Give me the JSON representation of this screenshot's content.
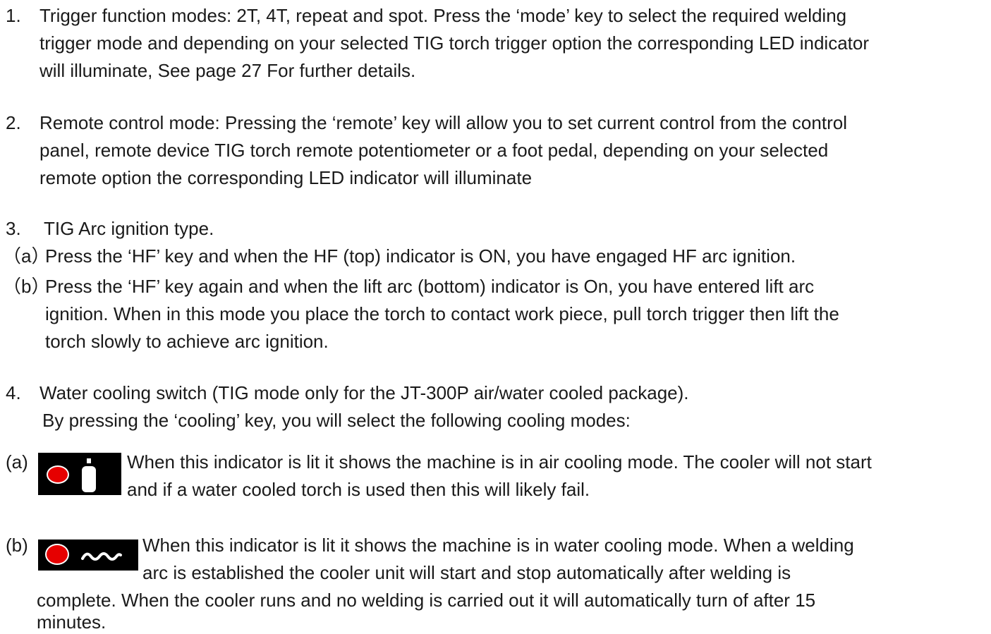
{
  "item1": {
    "number": "1.",
    "lines": [
      "Trigger function modes: 2T, 4T, repeat and spot. Press the ‘mode’ key to select the required welding",
      "trigger mode and depending on your selected TIG torch trigger option the corresponding LED indicator",
      "will illuminate, See page 27 For further details."
    ]
  },
  "item2": {
    "number": "2.",
    "lines": [
      "Remote control mode: Pressing the ‘remote’ key will allow you to set current control from the control",
      "panel, remote device TIG torch remote potentiometer or a foot pedal, depending on your selected",
      "remote option the corresponding LED indicator will illuminate"
    ]
  },
  "item3": {
    "number": "3.",
    "title": "TIG Arc ignition type.",
    "a_marker": "（a）",
    "a_text": "Press the ‘HF’ key and when the HF (top) indicator is ON, you have engaged HF arc ignition.",
    "b_marker": "（b）",
    "b_lines": [
      "Press the ‘HF’ key again and when the lift arc (bottom) indicator is On, you have entered lift arc",
      "ignition. When in this mode you place the torch to contact work piece, pull torch trigger then lift the",
      "torch slowly to achieve arc ignition."
    ]
  },
  "item4": {
    "number": "4.",
    "lines": [
      "Water cooling switch (TIG mode only for the JT-300P air/water cooled package).",
      "By pressing the ‘cooling’ key, you will select the following cooling modes:"
    ],
    "a_marker": "(a)",
    "a_lines": [
      "When this indicator is lit it shows the machine is in air cooling mode. The cooler will not start",
      "and if a water cooled torch is used then this will likely fail."
    ],
    "b_marker": "(b)",
    "b_lines": [
      "When this indicator is lit it shows the machine is in water cooling mode. When a welding",
      "arc is established the cooler unit will start and stop automatically after welding is",
      "complete. When the cooler runs and no welding is carried out it will automatically turn of after 15",
      "minutes."
    ]
  },
  "icons": {
    "air": "air-cooling-indicator-icon",
    "water": "water-cooling-indicator-icon"
  },
  "colors": {
    "led": "#e60000",
    "panel": "#000000"
  }
}
